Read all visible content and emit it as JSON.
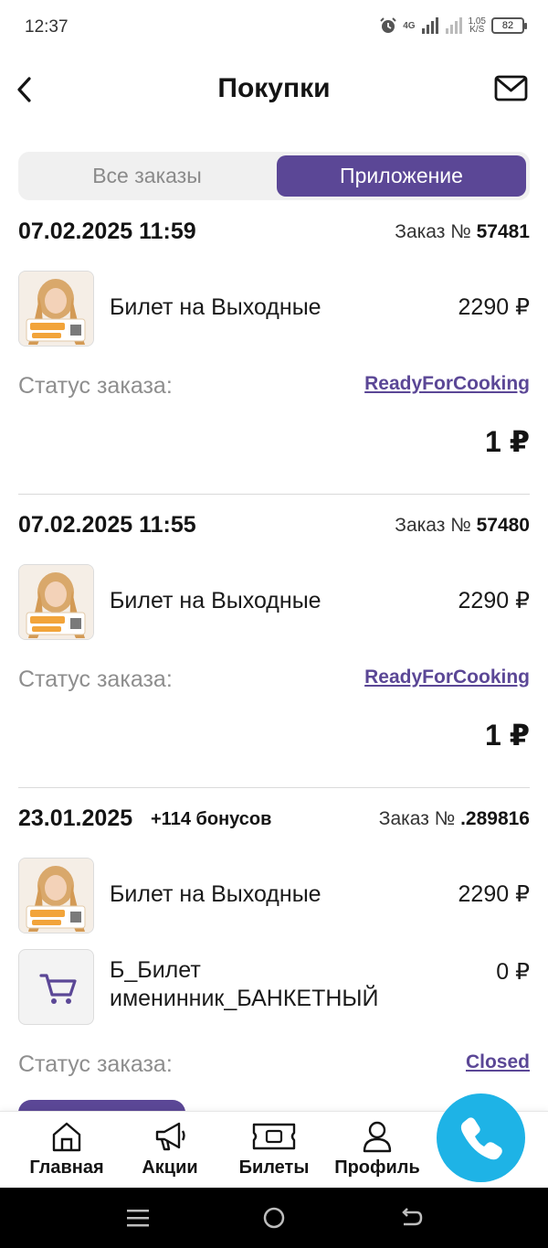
{
  "status_bar": {
    "time": "12:37",
    "network": "4G",
    "speed_value": "1,05",
    "speed_unit": "K/S",
    "battery": "82"
  },
  "header": {
    "title": "Покупки",
    "back_icon": "chevron-left-icon",
    "mail_icon": "mail-icon"
  },
  "tabs": {
    "all": "Все заказы",
    "app": "Приложение",
    "active": "app"
  },
  "orders": [
    {
      "date": "07.02.2025 11:59",
      "order_label": "Заказ №",
      "order_number": "57481",
      "items": [
        {
          "name": "Билет на Выходные",
          "price": "2290 ₽"
        }
      ],
      "status_label": "Статус заказа:",
      "status": "ReadyForCooking",
      "total": "1 ₽"
    },
    {
      "date": "07.02.2025 11:55",
      "order_label": "Заказ №",
      "order_number": "57480",
      "items": [
        {
          "name": "Билет на Выходные",
          "price": "2290 ₽"
        }
      ],
      "status_label": "Статус заказа:",
      "status": "ReadyForCooking",
      "total": "1 ₽"
    },
    {
      "date": "23.01.2025",
      "bonus": "+114 бонусов",
      "order_label": "Заказ №",
      "order_number": ".289816",
      "items": [
        {
          "name": "Билет на Выходные",
          "price": "2290 ₽"
        },
        {
          "name_line1": "Б_Билет",
          "name_line2": "именинник_БАНКЕТНЫЙ",
          "price": "0 ₽"
        }
      ],
      "status_label": "Статус заказа:",
      "status": "Closed"
    }
  ],
  "bottom_nav": [
    {
      "label": "Главная",
      "icon": "home-icon"
    },
    {
      "label": "Акции",
      "icon": "megaphone-icon"
    },
    {
      "label": "Билеты",
      "icon": "ticket-icon"
    },
    {
      "label": "Профиль",
      "icon": "user-icon"
    }
  ],
  "call_button": {
    "icon": "phone-icon",
    "color": "#1eb3e6"
  },
  "colors": {
    "accent": "#5b4796",
    "call": "#1eb3e6"
  }
}
